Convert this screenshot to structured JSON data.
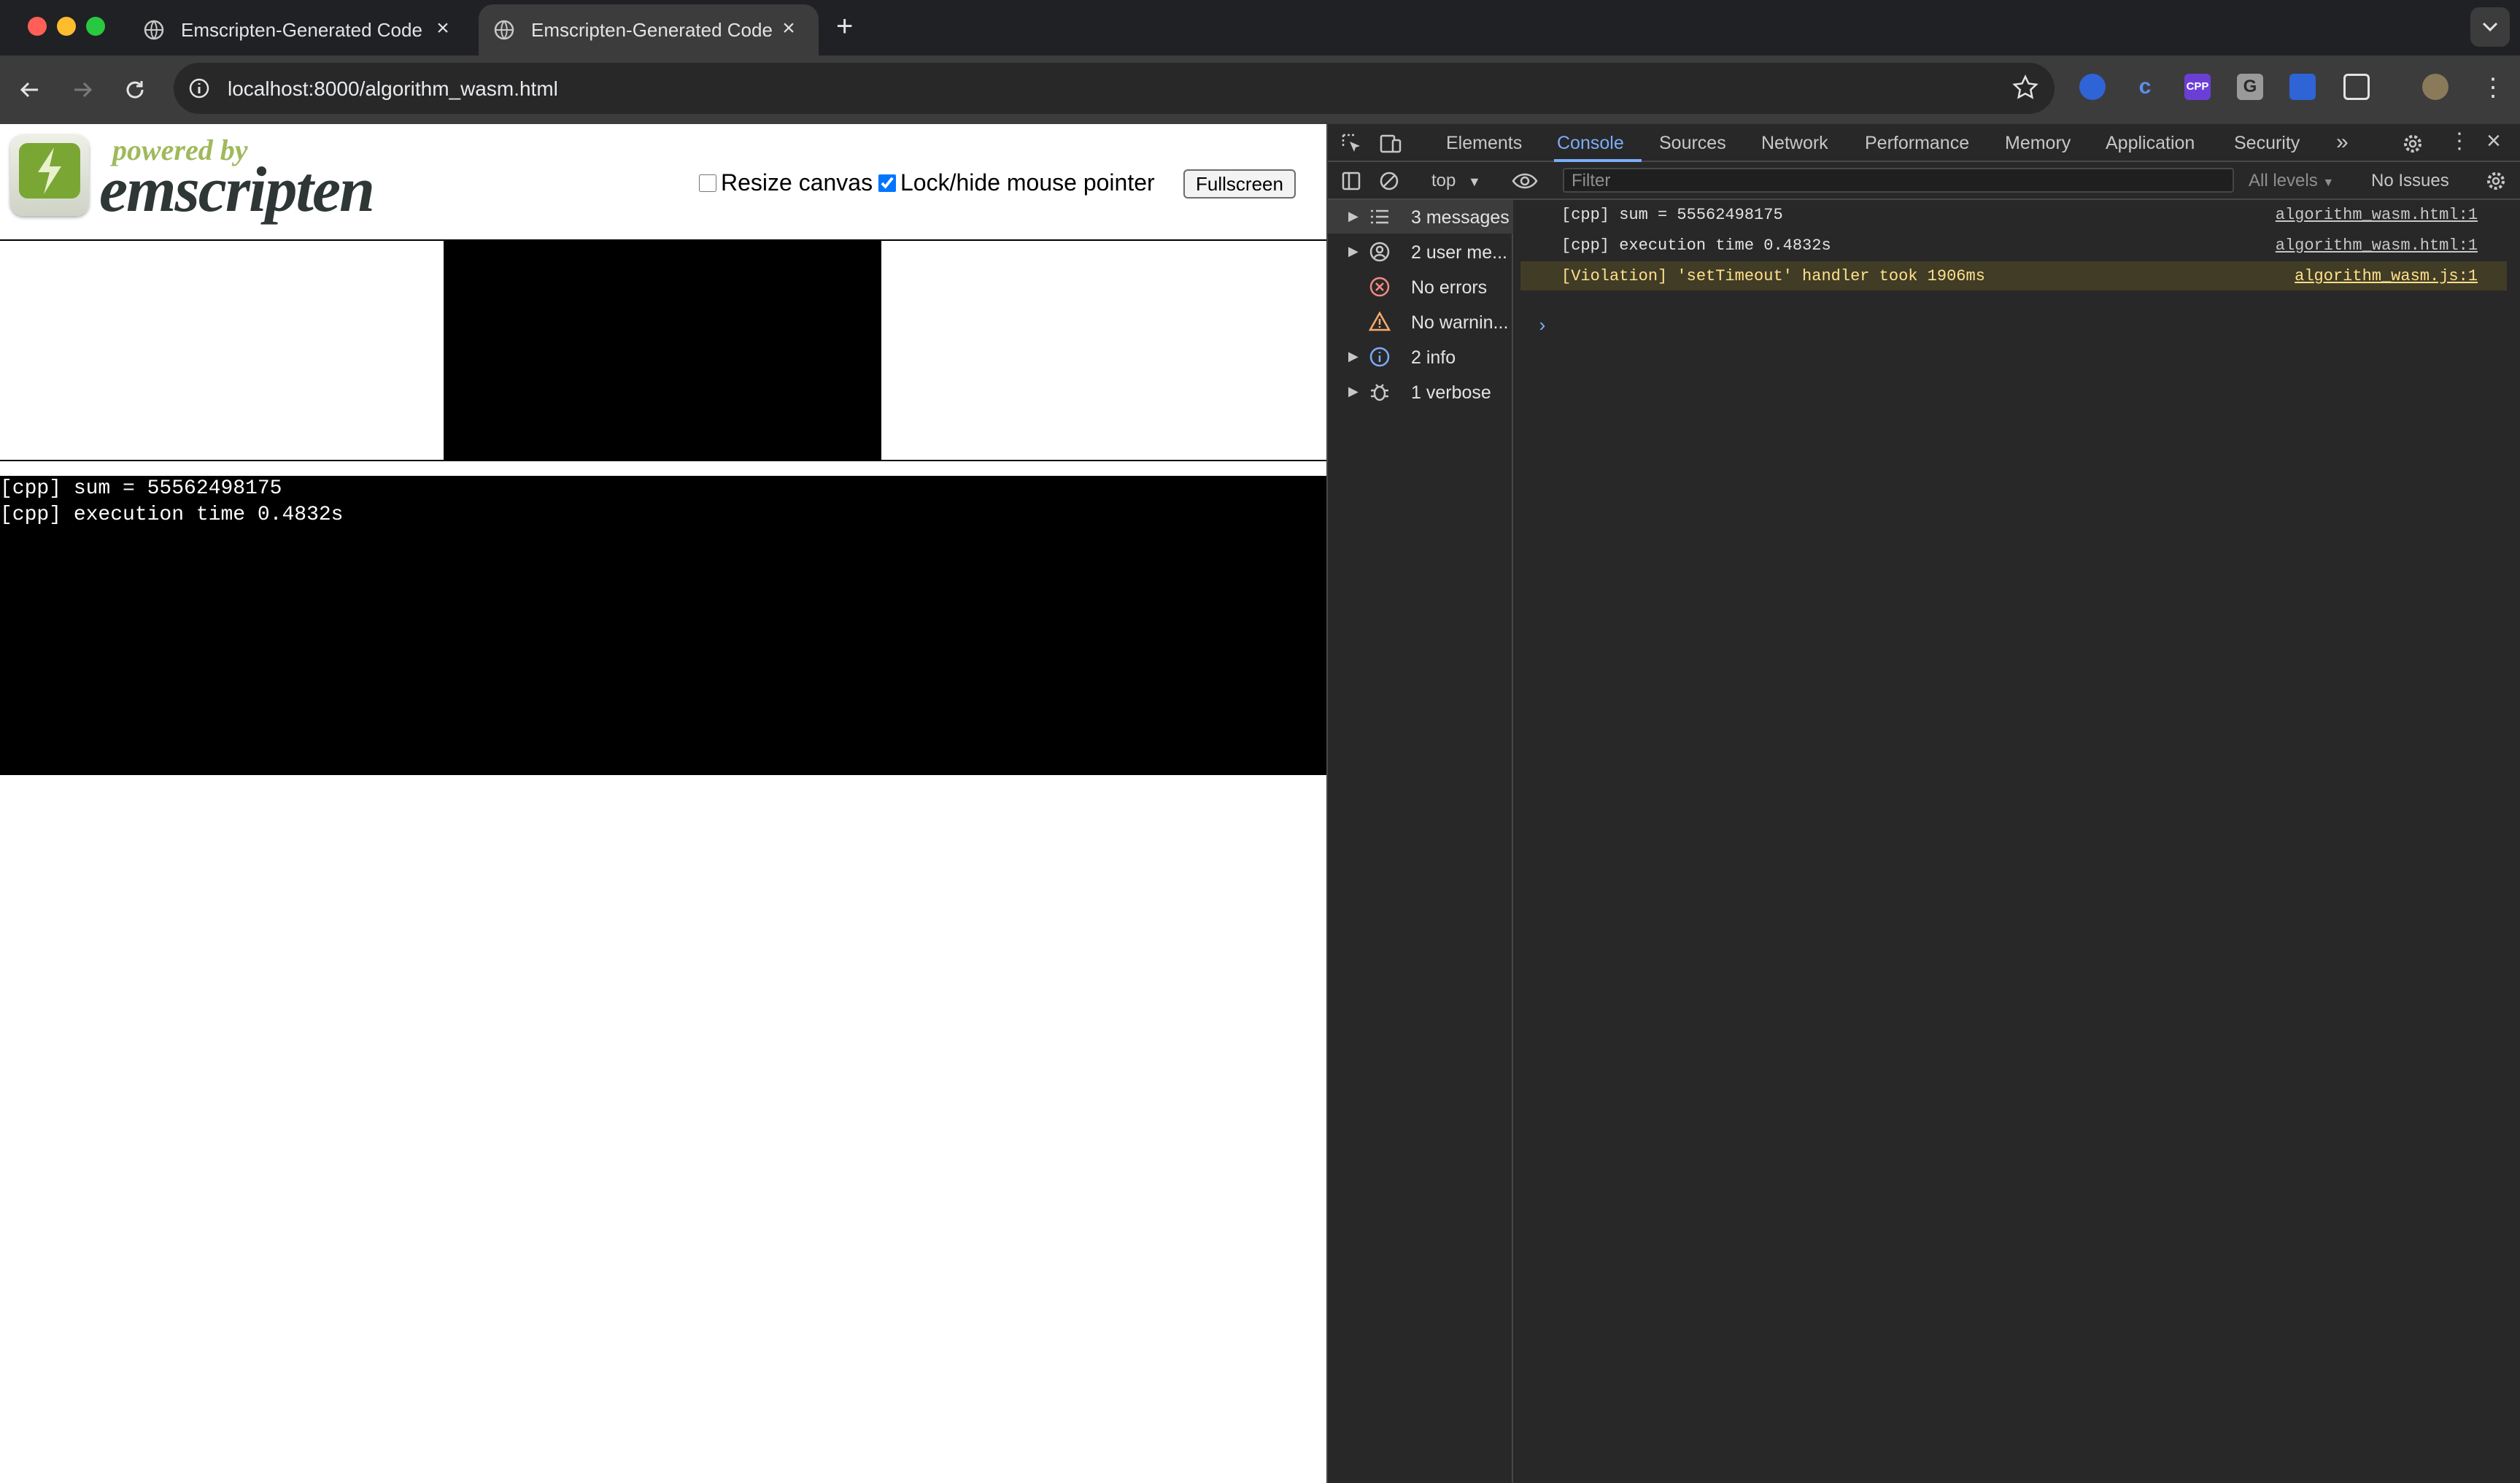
{
  "browser": {
    "tabs": [
      {
        "title": "Emscripten-Generated Code",
        "active": false
      },
      {
        "title": "Emscripten-Generated Code",
        "active": true
      }
    ],
    "url": "localhost:8000/algorithm_wasm.html",
    "extensions": [
      "copilot-icon",
      "c-icon",
      "cpp-icon",
      "g-icon",
      "reader-icon",
      "puzzle-icon"
    ]
  },
  "page": {
    "logo": {
      "powered_by": "powered by",
      "name": "emscripten"
    },
    "controls": {
      "resize_canvas_label": "Resize canvas",
      "resize_canvas_checked": false,
      "lock_pointer_label": "Lock/hide mouse pointer",
      "lock_pointer_checked": true,
      "fullscreen_label": "Fullscreen"
    },
    "output_lines": [
      "[cpp] sum = 55562498175",
      "[cpp] execution time 0.4832s"
    ]
  },
  "devtools": {
    "tabs": [
      "Elements",
      "Console",
      "Sources",
      "Network",
      "Performance",
      "Memory",
      "Application",
      "Security"
    ],
    "active_tab": "Console",
    "context": "top",
    "filter_placeholder": "Filter",
    "levels": "All levels",
    "issues": "No Issues",
    "sidebar": [
      {
        "label": "3 messages",
        "icon": "list-icon"
      },
      {
        "label": "2 user me...",
        "icon": "user-icon"
      },
      {
        "label": "No errors",
        "icon": "error-icon"
      },
      {
        "label": "No warnin...",
        "icon": "warning-icon"
      },
      {
        "label": "2 info",
        "icon": "info-icon"
      },
      {
        "label": "1 verbose",
        "icon": "bug-icon"
      }
    ],
    "messages": [
      {
        "text": "[cpp] sum = 55562498175",
        "source": "algorithm_wasm.html:1",
        "level": "log"
      },
      {
        "text": "[cpp] execution time 0.4832s",
        "source": "algorithm_wasm.html:1",
        "level": "log"
      },
      {
        "text": "[Violation] 'setTimeout' handler took 1906ms",
        "source": "algorithm_wasm.js:1",
        "level": "warning"
      }
    ]
  },
  "colors": {
    "accent": "#7cacf8",
    "devtools_bg": "#282828",
    "warning_bg": "#413c26"
  }
}
